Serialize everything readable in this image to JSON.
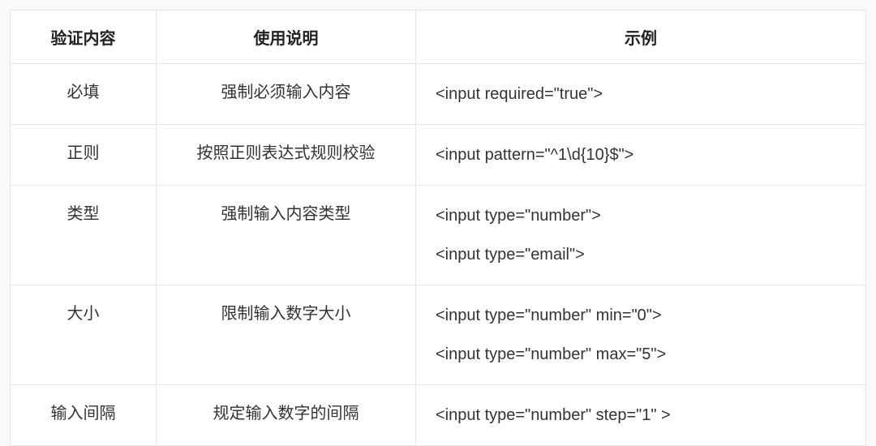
{
  "headers": {
    "col1": "验证内容",
    "col2": "使用说明",
    "col3": "示例"
  },
  "rows": [
    {
      "content": "必填",
      "desc": "强制必须输入内容",
      "examples": [
        "<input required=\"true\">"
      ]
    },
    {
      "content": "正则",
      "desc": "按照正则表达式规则校验",
      "examples": [
        "<input pattern=\"^1\\d{10}$\">"
      ]
    },
    {
      "content": "类型",
      "desc": "强制输入内容类型",
      "examples": [
        "<input type=\"number\">",
        "<input type=\"email\">"
      ]
    },
    {
      "content": "大小",
      "desc": "限制输入数字大小",
      "examples": [
        "<input type=\"number\" min=\"0\">",
        "<input type=\"number\" max=\"5\">"
      ]
    },
    {
      "content": "输入间隔",
      "desc": "规定输入数字的间隔",
      "examples": [
        "<input type=\"number\" step=\"1\" >"
      ]
    }
  ]
}
